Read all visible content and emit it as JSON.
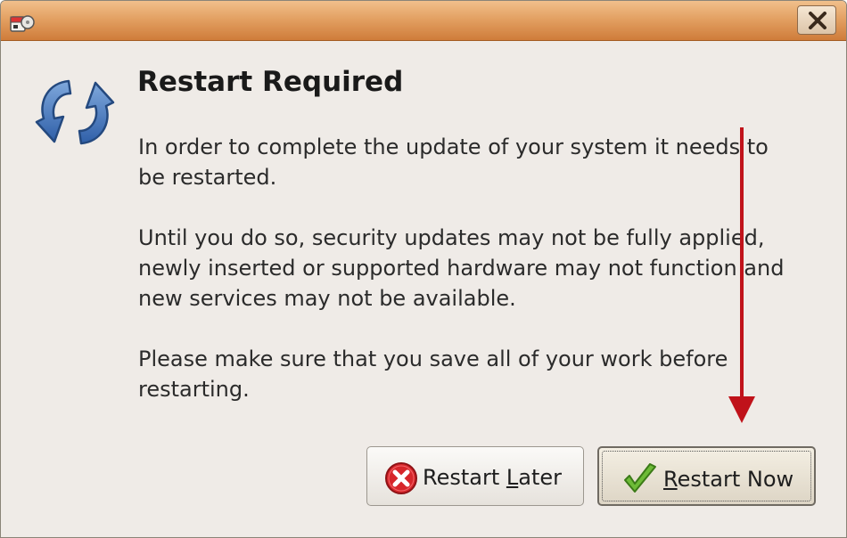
{
  "window": {
    "title": "",
    "app_icon": "system-restart-app-icon",
    "close_icon": "close-icon"
  },
  "dialog": {
    "icon": "refresh-arrows-icon",
    "title": "Restart Required",
    "paragraph1": [
      "In order to complete the update of your system it needs to",
      "be restarted."
    ],
    "paragraph2": [
      "Until you do so, security updates may not be fully applied,",
      "newly inserted or supported hardware may not function and",
      "new services may not be available."
    ],
    "paragraph3": [
      "Please make sure that you save all of your work before",
      "restarting."
    ]
  },
  "buttons": {
    "restart_later": {
      "icon": "red-x-circle-icon",
      "label_before": "Restart ",
      "mnemonic": "L",
      "label_after": "ater"
    },
    "restart_now": {
      "icon": "green-checkmark-icon",
      "mnemonic": "R",
      "label_after": "estart Now"
    }
  },
  "colors": {
    "titlebar_top": "#f1c08c",
    "titlebar_bottom": "#cf7c3a",
    "dialog_bg": "#efebe7",
    "annotation_arrow": "#c0121a",
    "later_icon": "#d7262b",
    "now_icon": "#5fae2d"
  }
}
